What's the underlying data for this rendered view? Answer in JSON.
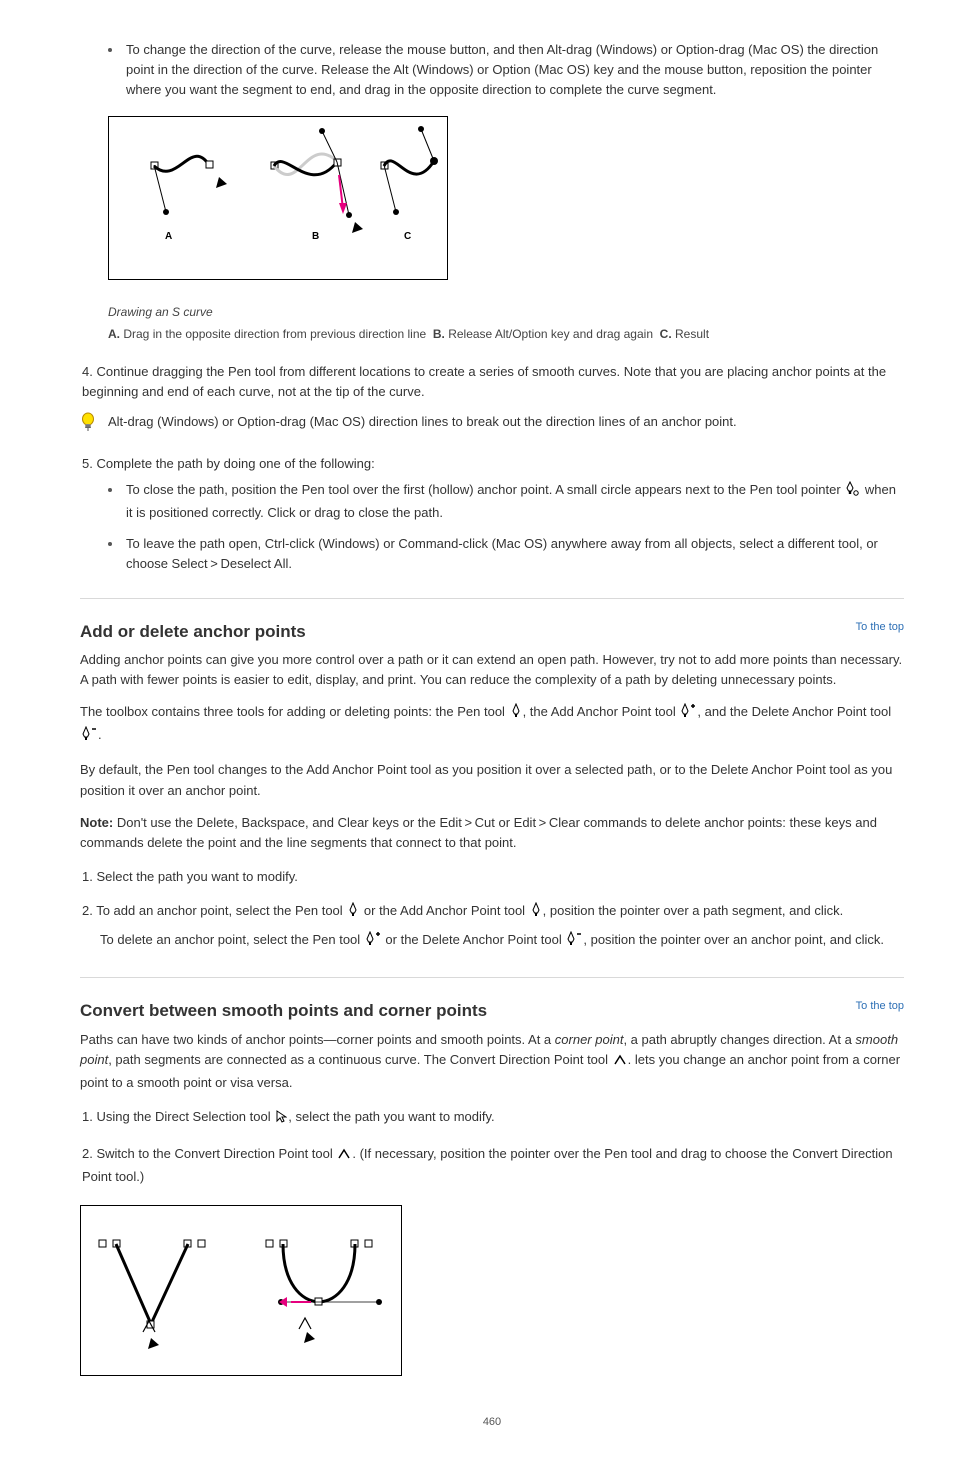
{
  "step3Bullet": "To change the direction of the curve, release the mouse button, and then Alt-drag (Windows) or Option-drag (Mac OS) the direction point in the direction of the curve. Release the Alt (Windows) or Option (Mac OS) key and the mouse button, reposition the pointer where you want the segment to end, and drag in the opposite direction to complete the curve segment.",
  "fig1Caption": "Drawing an S curve",
  "fig1A": "Drag in the opposite direction from previous direction line",
  "fig1B": "Release Alt/Option key and drag again",
  "fig1C": "Result",
  "step4": "Continue dragging the Pen tool from different locations to create a series of smooth curves. Note that you are placing anchor points at the beginning and end of each curve, not at the tip of the curve.",
  "tipText": "Alt-drag (Windows) or Option-drag (Mac OS) direction lines to break out the direction lines of an anchor point.",
  "step5bA": "To leave the path open, Ctrl-click (Windows) or Command-click (Mac OS) anywhere away from all objects, select a different tool, or choose Select > Deselect All.",
  "step5Intro": "Complete the path by doing one of the following:",
  "step5bClose": "To close the path, position the Pen tool over the first (hollow) anchor point. A small circle appears next to the Pen tool pointer      when it is positioned correctly. Click or drag to close the path.",
  "sec1Title": "Add or delete anchor points",
  "sec1Link": "To the top",
  "sec1p1_a": "Adding anchor points can give you more control over a path or it can extend an open path. However, try not to add more points than necessary. A path with fewer points is easier to edit, display, and print. You can reduce the complexity of a path by deleting unnecessary points.",
  "sec1p1_b": "The toolbox contains three tools for adding or deleting points: the Pen tool    , the Add Anchor Point tool    , and the Delete Anchor Point tool    .",
  "sec1p2": "By default, the Pen tool changes to the Add Anchor Point tool as you position it over a selected path, or to the Delete Anchor Point tool as you position it over an anchor point.",
  "sec1note_a": "Note:",
  "sec1note_b": "Don't use the Delete, Backspace, and Clear keys or the Edit > Cut or Edit > Clear commands to delete anchor points: these keys and commands delete the point and the line segments that connect to that point.",
  "sec1Select": "Select the path you want to modify.",
  "sec1SelectTool": "Select the Pen tool    , the Add Anchor Point tool    , or the Delete Anchor Point tool    .",
  "sec1AddDel": "To add an anchor point, position the pointer over a path segment and click. To delete an anchor point, position the pointer over an anchor point and click.",
  "sec2Title": "Convert between smooth points and corner points",
  "sec2Link": "To the top",
  "sec2p1": "Paths can have two kinds of anchor points—corner points and smooth points. At a",
  "sec2p1i": "corner point",
  "sec2p1b": ", a path abruptly changes direction. At a",
  "sec2p1i2": "smooth point",
  "sec2p1c": ", path segments are connected as a continuous curve. The Convert Direction Point tool    . lets you change an anchor point from a corner point to a smooth point or visa versa.",
  "sec2step1": "Using the Direct Selection tool    , select the path you want to modify.",
  "sec2step2": "Switch to the Convert Direction Point tool    . (If necessary, position the pointer over the Pen tool and drag to choose the Convert Direction Point tool.)",
  "pageNumber": "460"
}
